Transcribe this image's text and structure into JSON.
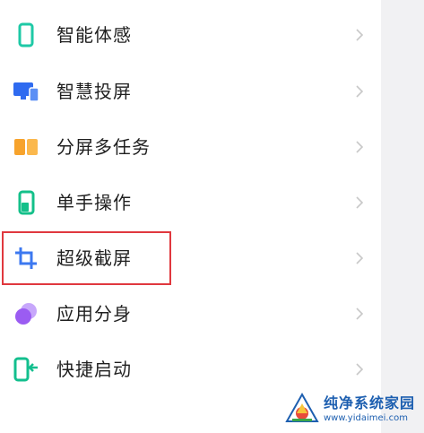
{
  "items": [
    {
      "label": "智能体感",
      "icon": "phone-outline-icon",
      "color": "#1ec9a6"
    },
    {
      "label": "智慧投屏",
      "icon": "monitor-phone-icon",
      "color": "#2f6bf0"
    },
    {
      "label": "分屏多任务",
      "icon": "split-screen-icon",
      "color": "#f7a32c"
    },
    {
      "label": "单手操作",
      "icon": "one-hand-phone-icon",
      "color": "#14c08a"
    },
    {
      "label": "超级截屏",
      "icon": "crop-icon",
      "color": "#3c78f0"
    },
    {
      "label": "应用分身",
      "icon": "clone-circles-icon",
      "color": "#9b5cf2"
    },
    {
      "label": "快捷启动",
      "icon": "quick-launch-icon",
      "color": "#13bf8e"
    }
  ],
  "highlight_color": "#e0383e",
  "watermark": {
    "title": "纯净系统家园",
    "url": "www.yidaimei.com"
  }
}
